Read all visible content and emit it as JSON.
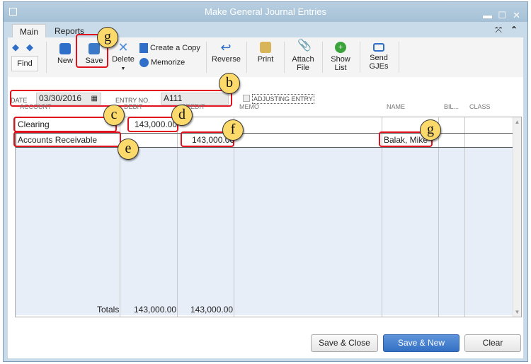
{
  "window": {
    "title": "Make General Journal Entries"
  },
  "tabs": [
    {
      "label": "Main"
    },
    {
      "label": "Reports"
    }
  ],
  "toolbar": {
    "find": "Find",
    "new": "New",
    "save": "Save",
    "delete": "Delete",
    "create_copy": "Create a Copy",
    "memorize": "Memorize",
    "reverse": "Reverse",
    "print": "Print",
    "attach_file": "Attach File",
    "show_list": "Show List",
    "send_gjes": "Send GJEs"
  },
  "form": {
    "date_label": "DATE",
    "date_value": "03/30/2016",
    "entry_label": "ENTRY NO.",
    "entry_value": "A111",
    "adjusting_label": "ADJUSTING ENTRY"
  },
  "grid": {
    "headers": [
      "ACCOUNT",
      "DEBIT",
      "CREDIT",
      "MEMO",
      "NAME",
      "BIL...",
      "CLASS"
    ],
    "rows": [
      {
        "account": "Clearing",
        "debit": "143,000.00",
        "credit": "",
        "memo": "",
        "name": ""
      },
      {
        "account": "Accounts Receivable",
        "debit": "",
        "credit": "143,000.00",
        "memo": "",
        "name": "Balak, Mike"
      }
    ],
    "totals_label": "Totals",
    "total_debit": "143,000.00",
    "total_credit": "143,000.00"
  },
  "buttons": {
    "save_close": "Save & Close",
    "save_new": "Save & New",
    "clear": "Clear"
  },
  "callouts": {
    "save": "g",
    "header": "b",
    "account1": "c",
    "debit1": "d",
    "account2": "e",
    "credit2": "f",
    "name2": "g"
  }
}
